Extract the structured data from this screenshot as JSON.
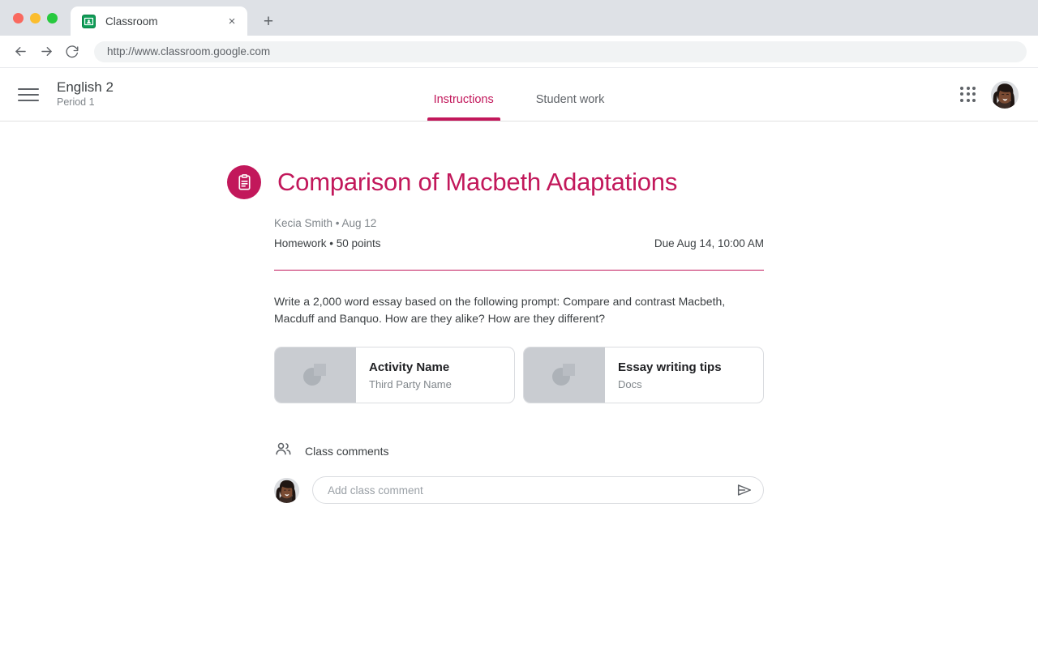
{
  "browser": {
    "tab": {
      "title": "Classroom",
      "favicon": "classroom-icon",
      "close_label": "×"
    },
    "new_tab_label": "+",
    "nav": {
      "back": "←",
      "forward": "→",
      "reload": "↻"
    },
    "omnibox": {
      "url": "http://www.classroom.google.com"
    }
  },
  "app_header": {
    "menu_icon": "hamburger-menu-icon",
    "course_name": "English 2",
    "course_section": "Period 1",
    "tabs": [
      {
        "label": "Instructions",
        "active": true
      },
      {
        "label": "Student work",
        "active": false
      }
    ],
    "apps_icon": "google-apps-grid-icon",
    "avatar": "user-avatar"
  },
  "assignment": {
    "badge_icon": "clipboard-assignment-icon",
    "title": "Comparison of Macbeth Adaptations",
    "author": "Kecia Smith",
    "separator": "•",
    "posted_date": "Aug 12",
    "byline": "Kecia Smith  • Aug 12",
    "category": "Homework",
    "points": "50 points",
    "type_points": "Homework • 50 points",
    "due": "Due Aug 14, 10:00 AM",
    "description": "Write a 2,000 word essay based on the following prompt: Compare and contrast Macbeth, Macduff and Banquo. How are they alike? How are they different?",
    "attachments": [
      {
        "title": "Activity Name",
        "subtitle": "Third Party Name",
        "thumb_icon": "placeholder-thumbnail-icon"
      },
      {
        "title": "Essay writing tips",
        "subtitle": "Docs",
        "thumb_icon": "placeholder-thumbnail-icon"
      }
    ]
  },
  "comments": {
    "icon": "people-icon",
    "label": "Class comments",
    "avatar": "user-avatar",
    "input_value": "",
    "placeholder": "Add class comment",
    "send_icon": "send-icon"
  },
  "colors": {
    "accent": "#c2185b",
    "text_primary": "#3c4043",
    "text_secondary": "#80868b",
    "chrome_bg": "#dee1e6",
    "thumb_bg": "#c9ccd1"
  }
}
